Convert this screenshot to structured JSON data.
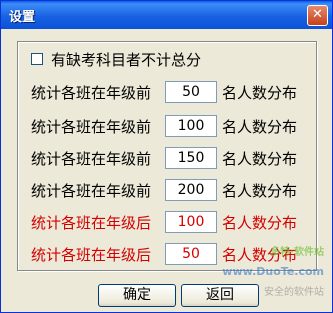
{
  "window": {
    "title": "设置",
    "close_glyph": "✕"
  },
  "options": {
    "exclude_missing_label": "有缺考科目者不计总分",
    "exclude_missing_checked": false
  },
  "rows": [
    {
      "prefix": "统计各班在年级前",
      "value": "50",
      "suffix": "名人数分布",
      "color": "#000000"
    },
    {
      "prefix": "统计各班在年级前",
      "value": "100",
      "suffix": "名人数分布",
      "color": "#000000"
    },
    {
      "prefix": "统计各班在年级前",
      "value": "150",
      "suffix": "名人数分布",
      "color": "#000000"
    },
    {
      "prefix": "统计各班在年级前",
      "value": "200",
      "suffix": "名人数分布",
      "color": "#000000"
    },
    {
      "prefix": "统计各班在年级后",
      "value": "100",
      "suffix": "名人数分布",
      "color": "#d40000"
    },
    {
      "prefix": "统计各班在年级后",
      "value": "50",
      "suffix": "名人数分布",
      "color": "#d40000"
    }
  ],
  "buttons": {
    "ok_label": "确定",
    "back_label": "返回"
  },
  "watermark": {
    "line1": "多特·软件站",
    "line2": "www.DuoTe.com",
    "line3": "安全的软件站"
  }
}
